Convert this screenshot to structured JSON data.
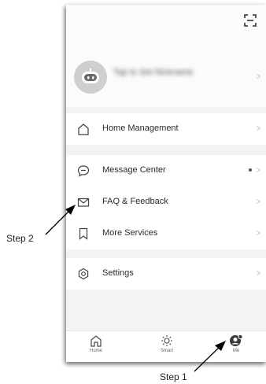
{
  "profile": {
    "name_blurred": "Tap to Set Nickname"
  },
  "menu": {
    "home_management": "Home Management",
    "message_center": "Message Center",
    "faq_feedback": "FAQ & Feedback",
    "more_services": "More Services",
    "settings": "Settings"
  },
  "tabs": {
    "home": "Home",
    "smart": "Smart",
    "me": "Me"
  },
  "annotations": {
    "step1": "Step 1",
    "step2": "Step 2"
  },
  "icons": {
    "scan": "scan-icon",
    "avatar": "robot-avatar-icon",
    "home": "house-icon",
    "message": "chat-bubble-icon",
    "faq": "envelope-icon",
    "services": "bookmark-icon",
    "settings": "gear-icon",
    "tab_home": "house-icon",
    "tab_smart": "sun-icon",
    "tab_me": "person-gear-icon"
  },
  "colors": {
    "background": "#f3f3f3",
    "card": "#ffffff",
    "text": "#2b2b2b",
    "chevron": "#b8b8b8"
  }
}
